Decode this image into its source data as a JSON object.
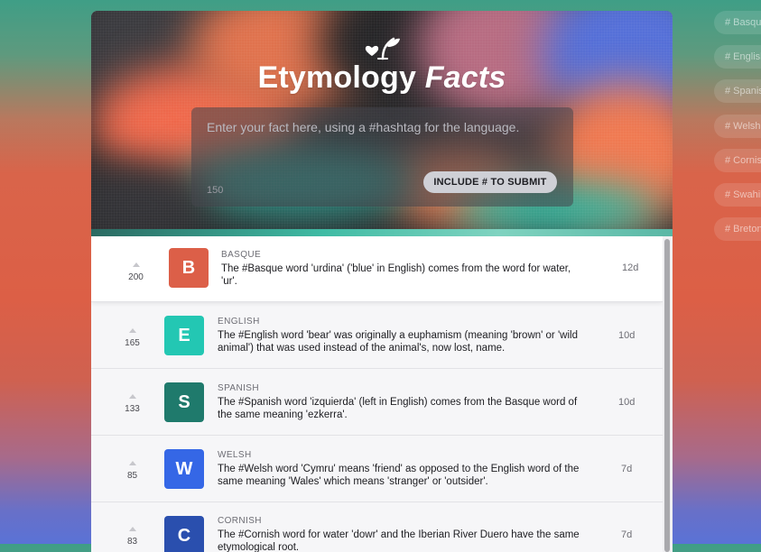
{
  "app": {
    "title_plain": "Etymology",
    "title_italic": "Facts",
    "logo_icon": "heart-sprout-icon"
  },
  "composer": {
    "placeholder": "Enter your fact here, using a #hashtag for the language.",
    "char_count": "150",
    "submit_label": "INCLUDE # TO SUBMIT"
  },
  "facts": [
    {
      "votes": "200",
      "letter": "B",
      "color": "#dc5f48",
      "language": "BASQUE",
      "text": "The #Basque word 'urdina' ('blue' in English) comes from the word for water, 'ur'.",
      "age": "12d"
    },
    {
      "votes": "165",
      "letter": "E",
      "color": "#23c7b3",
      "language": "ENGLISH",
      "text": "The #English word 'bear' was originally a euphamism (meaning 'brown' or 'wild animal') that was used instead of the animal's, now lost, name.",
      "age": "10d"
    },
    {
      "votes": "133",
      "letter": "S",
      "color": "#1f7a6c",
      "language": "SPANISH",
      "text": "The #Spanish word 'izquierda' (left in English) comes from the Basque word of the same meaning 'ezkerra'.",
      "age": "10d"
    },
    {
      "votes": "85",
      "letter": "W",
      "color": "#3567e6",
      "language": "WELSH",
      "text": "The #Welsh word 'Cymru' means 'friend' as opposed to the English word of the same meaning 'Wales' which means 'stranger' or 'outsider'.",
      "age": "7d"
    },
    {
      "votes": "83",
      "letter": "C",
      "color": "#2a4fae",
      "language": "CORNISH",
      "text": "The #Cornish word for water 'dowr' and the Iberian River Duero have the same etymological root.",
      "age": "7d"
    }
  ],
  "hashtags": [
    "# Basque",
    "# English",
    "# Spanish",
    "# Welsh",
    "# Cornish",
    "# Swahili",
    "# Breton"
  ]
}
